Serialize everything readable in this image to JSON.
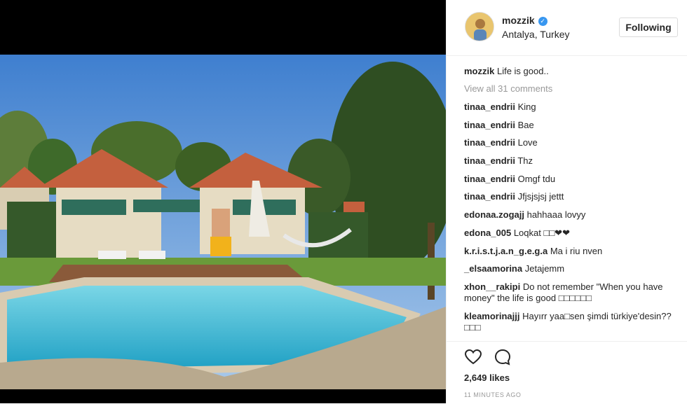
{
  "post": {
    "username": "mozzik",
    "location": "Antalya, Turkey",
    "follow_label": "Following",
    "caption_user": "mozzik",
    "caption_text": "Life is good..",
    "view_all": "View all 31 comments",
    "comments": [
      {
        "user": "tinaa_endrii",
        "text": "King"
      },
      {
        "user": "tinaa_endrii",
        "text": "Bae"
      },
      {
        "user": "tinaa_endrii",
        "text": "Love"
      },
      {
        "user": "tinaa_endrii",
        "text": "Thz"
      },
      {
        "user": "tinaa_endrii",
        "text": "Omgf tdu"
      },
      {
        "user": "tinaa_endrii",
        "text": "Jfjsjsjsj jettt"
      },
      {
        "user": "edonaa.zogajj",
        "text": "hahhaaa lovyy"
      },
      {
        "user": "edonа_005",
        "text": "Loqkat □□❤❤"
      },
      {
        "user": "k.r.i.s.t.j.a.n_g.e.g.a",
        "text": "Ma i riu nven"
      },
      {
        "user": "_elsaamorina",
        "text": "Jetajemm"
      },
      {
        "user": "xhon__rakipi",
        "text": "Do not remember \"When you have money\" the life is good □□□□□□"
      },
      {
        "user": "kleamorinajjj",
        "text": "Hayırr yaa□sen şimdi türkiye'desin??□□□"
      }
    ],
    "likes": "2,649 likes",
    "time": "11 MINUTES AGO"
  },
  "icons": {
    "verified": "verified-badge-icon",
    "like": "heart-icon",
    "comment": "speech-bubble-icon"
  },
  "colors": {
    "verified": "#3897f0",
    "muted": "#999999",
    "border": "#dbdbdb"
  }
}
